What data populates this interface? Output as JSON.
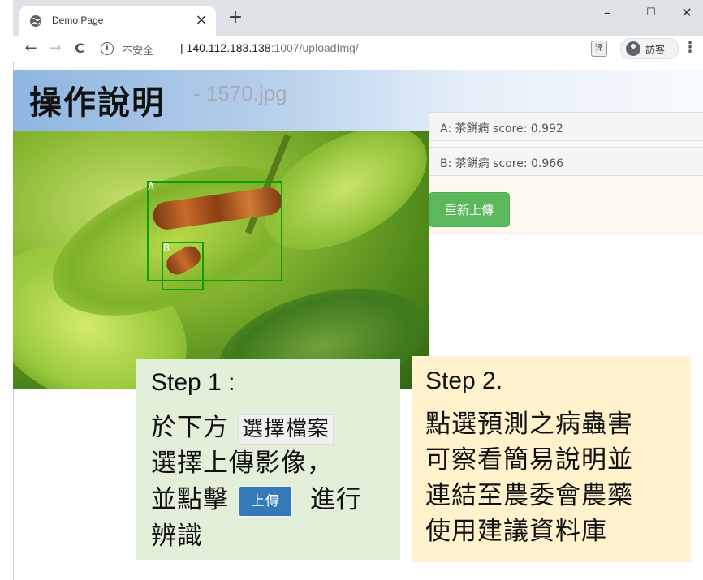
{
  "browser": {
    "tab_title": "Demo Page",
    "tab_close": "×",
    "new_tab": "+",
    "win_minimize": "–",
    "win_maximize": "☐",
    "win_close": "✕",
    "back": "←",
    "forward": "→",
    "reload": "C",
    "info_glyph": "i",
    "insecure_label": "不安全",
    "url_host": "| 140.112.183.138",
    "url_path": ":1007/uploadImg/",
    "translate_glyph": "译",
    "profile_name": "訪客",
    "menu": "⋮"
  },
  "page": {
    "title": "操作說明",
    "filename": "- 1570.jpg"
  },
  "detections": [
    {
      "label": "A",
      "text": "A: 茶餅病 score: 0.992"
    },
    {
      "label": "B",
      "text": "B: 茶餅病 score: 0.966"
    }
  ],
  "reupload_button": "重新上傳",
  "step1": {
    "title": "Step 1 :",
    "line1_pre": "於下方",
    "chip_file": "選擇檔案",
    "line2": "選擇上傳影像，",
    "line3_pre": "並點擊",
    "chip_upload": "上傳",
    "line3_post": "進行",
    "line4": "辨識"
  },
  "step2": {
    "title": "Step 2.",
    "line1": "點選預測之病蟲害",
    "line2": "可察看簡易說明並",
    "line3": "連結至農委會農藥",
    "line4": "使用建議資料庫"
  },
  "colors": {
    "bbox": "#0aa000",
    "reupload_bg": "#5cb85c",
    "upload_bg": "#337ab7",
    "card1_bg": "#e2efd9",
    "card2_bg": "#fff2cc"
  }
}
